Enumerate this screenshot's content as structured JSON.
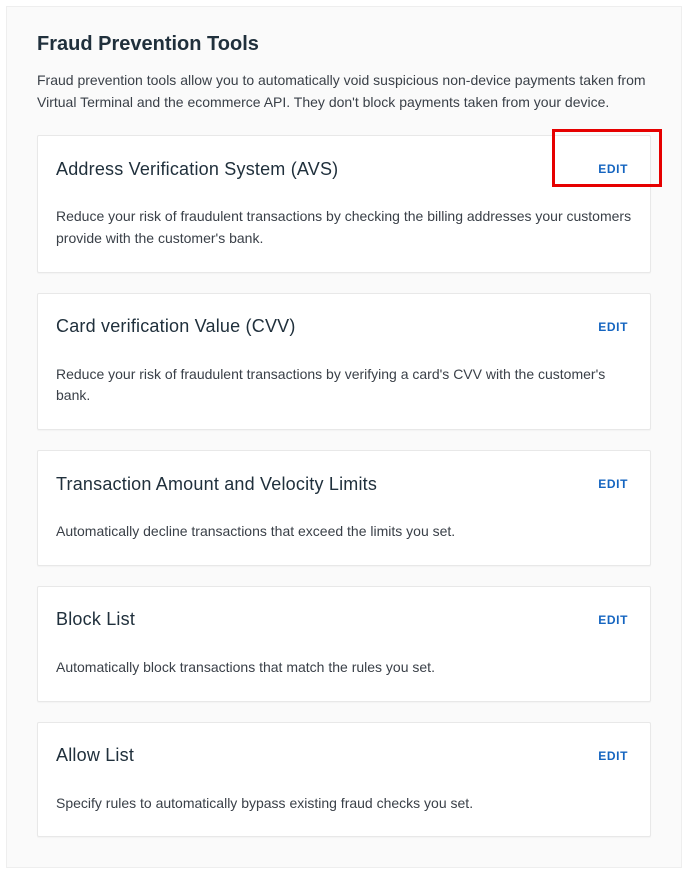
{
  "header": {
    "title": "Fraud Prevention Tools",
    "description": "Fraud prevention tools allow you to automatically void suspicious non-device payments taken from Virtual Terminal and the ecommerce API. They don't block payments taken from your device."
  },
  "actions": {
    "edit_label": "EDIT"
  },
  "cards": {
    "avs": {
      "title": "Address Verification System (AVS)",
      "body": "Reduce your risk of fraudulent transactions by checking the billing addresses your customers provide with the customer's bank."
    },
    "cvv": {
      "title": "Card verification Value (CVV)",
      "body": "Reduce your risk of fraudulent transactions by verifying a card's CVV with the customer's bank."
    },
    "velocity": {
      "title": "Transaction Amount and Velocity Limits",
      "body": "Automatically decline transactions that exceed the limits you set."
    },
    "blocklist": {
      "title": "Block List",
      "body": "Automatically block transactions that match the rules you set."
    },
    "allowlist": {
      "title": "Allow List",
      "body": "Specify rules to automatically bypass existing fraud checks you set."
    }
  }
}
